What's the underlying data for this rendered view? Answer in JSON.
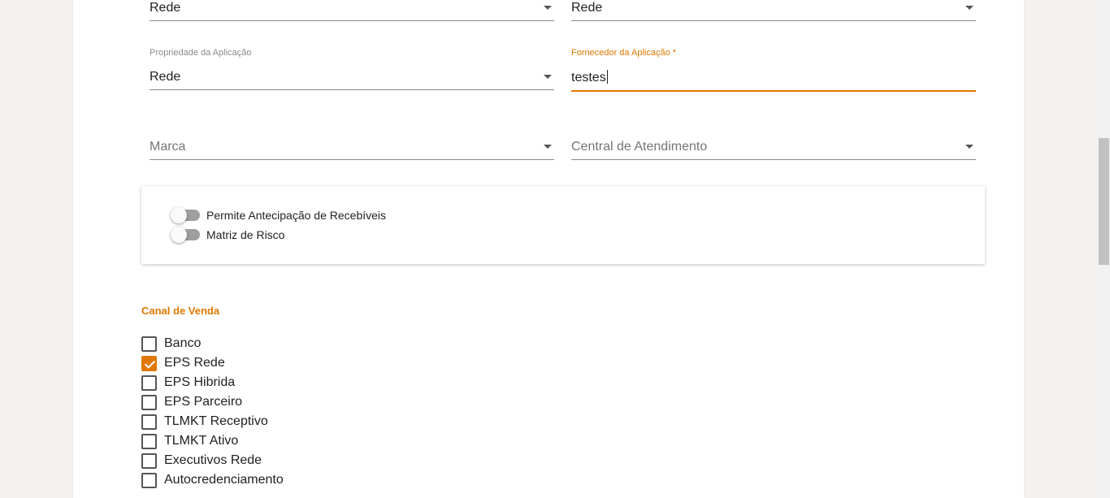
{
  "form": {
    "row0": {
      "left_value": "Rede",
      "right_value": "Rede"
    },
    "propriedade": {
      "label": "Propriedade da Aplicação",
      "value": "Rede"
    },
    "fornecedor": {
      "label": "Fornecedor da Aplicação *",
      "value": "testes"
    },
    "marca": {
      "placeholder": "Marca"
    },
    "central": {
      "placeholder": "Central de Atendimento"
    }
  },
  "toggles": [
    {
      "label": "Permite Antecipação de Recebíveis",
      "on": false
    },
    {
      "label": "Matriz de Risco",
      "on": false
    }
  ],
  "canal_venda": {
    "title": "Canal de Venda",
    "options": [
      {
        "label": "Banco",
        "checked": false
      },
      {
        "label": "EPS Rede",
        "checked": true
      },
      {
        "label": "EPS Hibrida",
        "checked": false
      },
      {
        "label": "EPS Parceiro",
        "checked": false
      },
      {
        "label": "TLMKT Receptivo",
        "checked": false
      },
      {
        "label": "TLMKT Ativo",
        "checked": false
      },
      {
        "label": "Executivos Rede",
        "checked": false
      },
      {
        "label": "Autocredenciamento",
        "checked": false
      }
    ]
  },
  "colors": {
    "accent": "#e07800",
    "background": "#f4f2ef"
  },
  "icons": {
    "select_caret": "chevron-down-icon",
    "checkbox_check": "check-icon"
  }
}
